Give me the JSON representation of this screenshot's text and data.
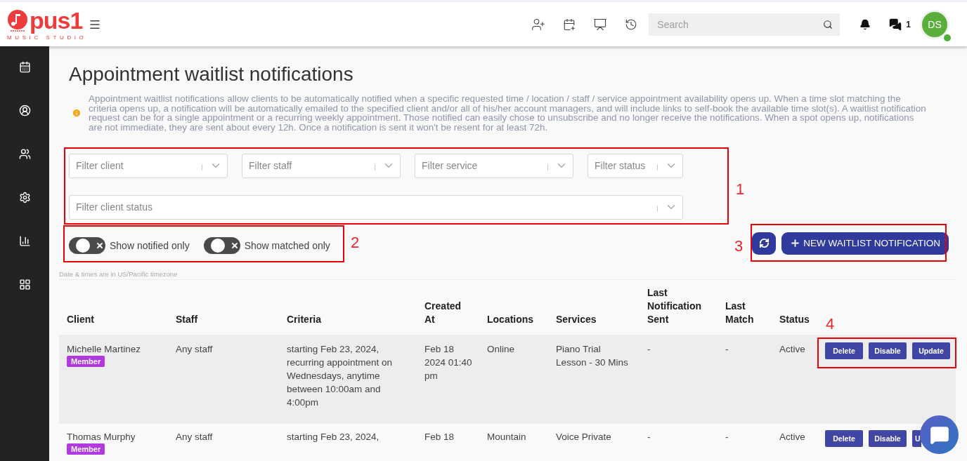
{
  "header": {
    "logo": {
      "name": "pus1",
      "tagline": "MUSIC STUDIO"
    },
    "search": {
      "placeholder": "Search"
    },
    "messages_count": "1",
    "avatar": {
      "initials": "DS",
      "online": true
    }
  },
  "page": {
    "title": "Appointment waitlist notifications",
    "info": "Appointment waitlist notifications allow clients to be automatically notified when a specific requested time / location / staff / service appointment availability opens up. When a time slot matching the criteria opens up, a notification will be automatically emailed to the specified client and/or all of his/her account managers, and will include links to self-book the available time slot(s). A waitlist notification request can be for a single appointment or a recurring weekly appointment. Those notified can easily chose to unsubscribe and no longer receive the notifications. When a spot opens up, notifications are not immediate, they are sent about every 12h. Once a notification is sent it won't be resent for at least 72h."
  },
  "filters": {
    "row": [
      {
        "placeholder": "Filter client"
      },
      {
        "placeholder": "Filter staff"
      },
      {
        "placeholder": "Filter service"
      },
      {
        "placeholder": "Filter status"
      }
    ],
    "wide": {
      "placeholder": "Filter client status"
    }
  },
  "toggles": [
    {
      "label": "Show notified only",
      "on": false
    },
    {
      "label": "Show matched only",
      "on": false
    }
  ],
  "new_button": "NEW WAITLIST NOTIFICATION",
  "timezone_note": "Date & times are in US/Pacific timezone",
  "table": {
    "columns": [
      "Client",
      "Staff",
      "Criteria",
      "Created At",
      "Locations",
      "Services",
      "Last Notification Sent",
      "Last Match",
      "Status"
    ],
    "rows": [
      {
        "client": "Michelle Martinez",
        "badge": "Member",
        "staff": "Any staff",
        "criteria": "starting Feb 23, 2024, recurring appointment on Wednesdays, anytime between 10:00am and 4:00pm",
        "created": "Feb 18 2024 01:40 pm",
        "locations": "Online",
        "services": "Piano Trial Lesson - 30 Mins",
        "last_notification": "-",
        "last_match": "-",
        "status": "Active",
        "highlighted": true,
        "actions": [
          {
            "label": "Delete",
            "cut": false
          },
          {
            "label": "Disable",
            "cut": false
          },
          {
            "label": "Update",
            "cut": false
          }
        ]
      },
      {
        "client": "Thomas Murphy",
        "badge": "Member",
        "staff": "Any staff",
        "criteria": "starting Feb 23, 2024,",
        "created": "Feb 18",
        "locations": "Mountain",
        "services": "Voice Private",
        "last_notification": "-",
        "last_match": "-",
        "status": "Active",
        "highlighted": false,
        "actions": [
          {
            "label": "Delete",
            "cut": false
          },
          {
            "label": "Disable",
            "cut": false
          },
          {
            "label": "U",
            "cut": true
          }
        ]
      }
    ]
  },
  "annotations": [
    {
      "label": "1"
    },
    {
      "label": "2"
    },
    {
      "label": "3"
    },
    {
      "label": "4"
    }
  ]
}
